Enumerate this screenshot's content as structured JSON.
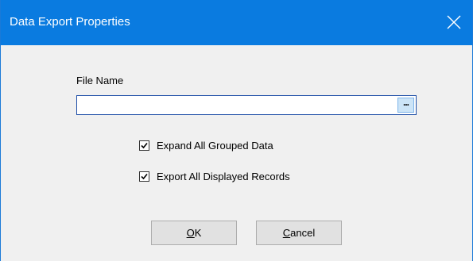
{
  "window": {
    "title": "Data Export Properties",
    "accent_color": "#0a7be0"
  },
  "form": {
    "file_name_label": "File Name",
    "file_name_value": "",
    "browse_label": "...",
    "options": [
      {
        "label": "Expand All Grouped Data",
        "checked": true
      },
      {
        "label": "Export All Displayed Records",
        "checked": true
      }
    ]
  },
  "buttons": {
    "ok_mnemonic": "O",
    "ok_rest": "K",
    "cancel_mnemonic": "C",
    "cancel_rest": "ancel"
  },
  "icons": {
    "close": "close-icon",
    "checkmark": "checkmark-icon"
  }
}
